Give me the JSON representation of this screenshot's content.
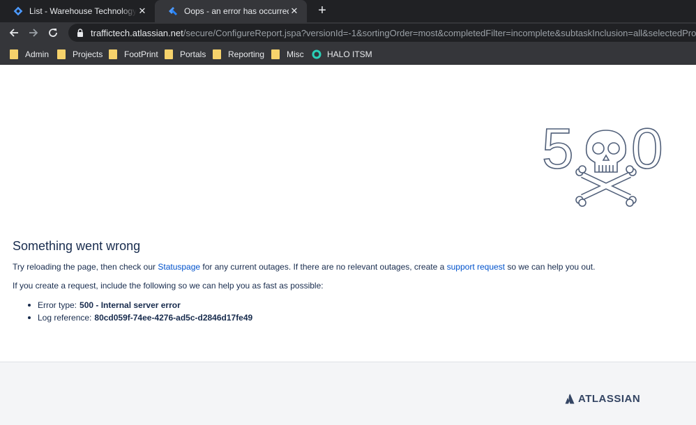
{
  "tabs": [
    {
      "title": "List - Warehouse Technology Solutions",
      "icon": "jira-diamond-icon"
    },
    {
      "title": "Oops - an error has occurred",
      "icon": "jira-icon"
    }
  ],
  "address_bar": {
    "host": "traffictech.atlassian.net",
    "path": "/secure/ConfigureReport.jspa?versionId=-1&sortingOrder=most&completedFilter=incomplete&subtaskInclusion=all&selectedProjectId"
  },
  "bookmarks": [
    {
      "label": "Admin"
    },
    {
      "label": "Projects"
    },
    {
      "label": "FootPrint"
    },
    {
      "label": "Portals"
    },
    {
      "label": "Reporting"
    },
    {
      "label": "Misc"
    },
    {
      "label": "HALO ITSM"
    }
  ],
  "error": {
    "heading": "Something went wrong",
    "p1_before": "Try reloading the page, then check our ",
    "p1_link1": "Statuspage",
    "p1_middle": " for any current outages. If there are no relevant outages, create a ",
    "p1_link2": "support request",
    "p1_after": " so we can help you out.",
    "p2": "If you create a request, include the following so we can help you as fast as possible:",
    "error_type_label": "Error type:",
    "error_type_value": "500 - Internal server error",
    "log_ref_label": "Log reference:",
    "log_ref_value": "80cd059f-74ee-4276-ad5c-d2846d17fe49",
    "illustration_digits": [
      "5",
      "0"
    ]
  },
  "footer": {
    "brand": "ATLASSIAN"
  },
  "colors": {
    "text": "#172b4d",
    "link": "#0052cc",
    "chrome_dark": "#202124",
    "chrome": "#35363a"
  }
}
